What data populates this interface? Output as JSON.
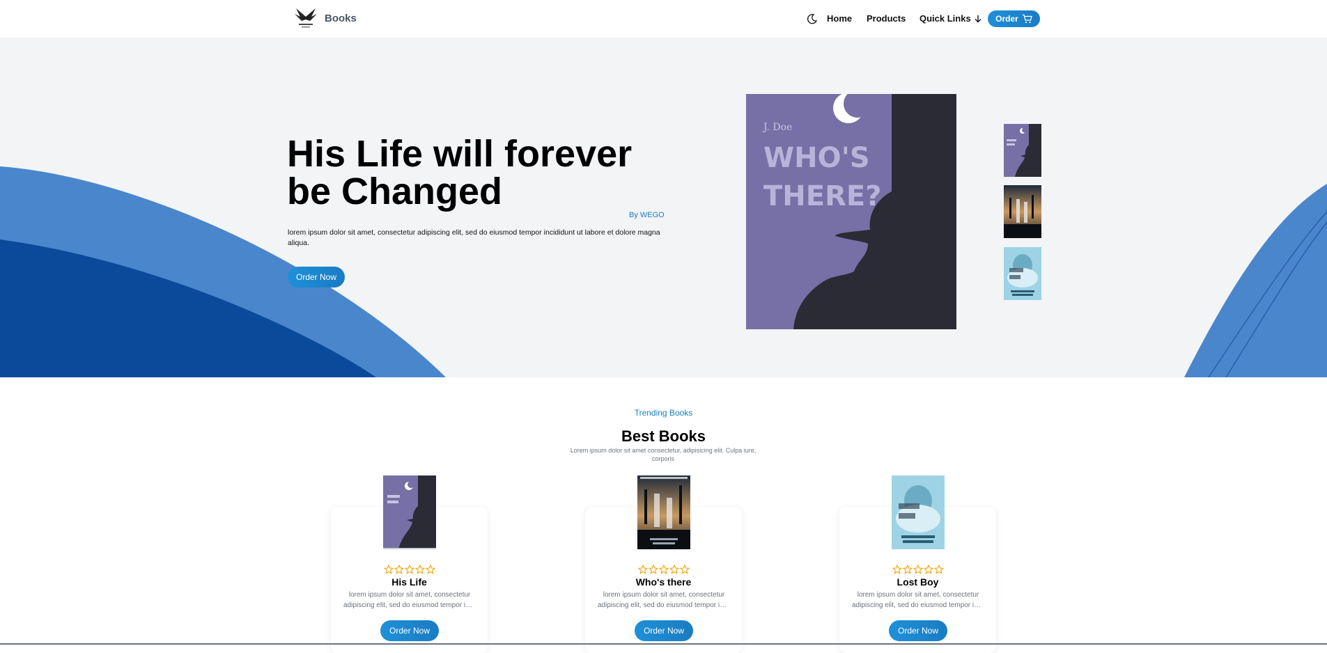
{
  "nav": {
    "brand": "Books",
    "links": [
      "Home",
      "Products",
      "Quick Links"
    ],
    "order_label": "Order"
  },
  "hero": {
    "title": "His Life will forever be Changed",
    "author": "By WEGO",
    "description": "lorem ipsum dolor sit amet, consectetur adipiscing elit, sed do eiusmod tempor incididunt ut labore et dolore magna aliqua.",
    "button_label": "Order Now",
    "featured_cover": {
      "author": "J. Doe",
      "title_lines": [
        "WHO'S",
        "THERE?"
      ]
    }
  },
  "trending": {
    "eyebrow": "Trending Books",
    "title": "Best Books",
    "subtitle": "Lorem ipsum dolor sit amet consectetur, adipisicing elit. Culpa iure, corporis",
    "books": [
      {
        "title": "His Life",
        "desc_line1": "lorem ipsum dolor sit amet, consectetur",
        "desc_line2": "adipiscing elit, sed do eiusmod tempor incididunt",
        "rating": 0,
        "button": "Order Now"
      },
      {
        "title": "Who's there",
        "desc_line1": "lorem ipsum dolor sit amet, consectetur",
        "desc_line2": "adipiscing elit, sed do eiusmod tempor incididunt",
        "rating": 0,
        "button": "Order Now"
      },
      {
        "title": "Lost Boy",
        "desc_line1": "lorem ipsum dolor sit amet, consectetur",
        "desc_line2": "adipiscing elit, sed do eiusmod tempor incididunt",
        "rating": 0,
        "button": "Order Now"
      }
    ]
  },
  "colors": {
    "accent": "#1a7cc4",
    "wave_dark": "#0b4a9a",
    "wave_light": "#4a86cc",
    "cover_purple": "#7670a6",
    "cover_dark": "#2b2b35"
  },
  "icons": [
    "logo-bird-icon",
    "moon-icon",
    "arrow-down-icon",
    "cart-icon",
    "star-icon"
  ]
}
